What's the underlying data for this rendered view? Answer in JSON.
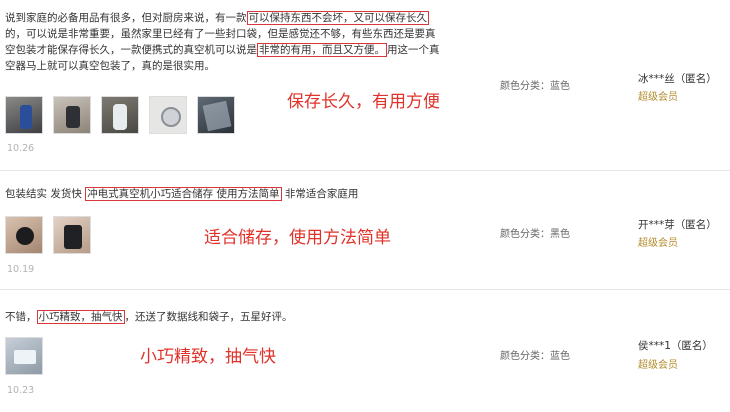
{
  "reviews": [
    {
      "text_lines": [
        [
          "说到家庭的必备用品有很多，但对厨房来说，有一款",
          "可以保持东西不会坏，又可以保存长久"
        ],
        [
          "的，可以说是非常重要，虽然家里已经有了一些封口袋，但是感觉还不够，有些东西还是要真"
        ],
        [
          "空包装才能保存得长久，一款便携式的真空机可以说是",
          "非常的有用，而且又方便。",
          "用这一个真"
        ],
        [
          "空器马上就可以真空包装了，真的是很实用。"
        ]
      ],
      "annotation": "保存长久，有用方便",
      "date": "10.26",
      "color_label": "颜色分类：蓝色",
      "user": "冰***丝（匿名）",
      "member": "超级会员",
      "photos": [
        "bottle-photo",
        "gadget-photo",
        "device-photo",
        "valve-photo",
        "bag-photo"
      ]
    },
    {
      "text_prefix": "包装结实 发货快 ",
      "text_highlight": "冲电式真空机小巧适合储存 使用方法简单",
      "text_suffix": " 非常适合家庭用",
      "annotation": "适合储存，使用方法简单",
      "date": "10.19",
      "color_label": "颜色分类：黑色",
      "user": "开***芽（匿名）",
      "member": "超级会员",
      "photos": [
        "device-hand-photo",
        "device-black-photo"
      ]
    },
    {
      "text_prefix": "不错，",
      "text_highlight": "小巧精致，抽气快",
      "text_suffix": "，还送了数据线和袋子，五星好评。",
      "annotation": "小巧精致，抽气快",
      "date": "10.23",
      "color_label": "颜色分类：蓝色",
      "user": "侯***1（匿名）",
      "member": "超级会员",
      "photos": [
        "product-photo"
      ]
    }
  ]
}
